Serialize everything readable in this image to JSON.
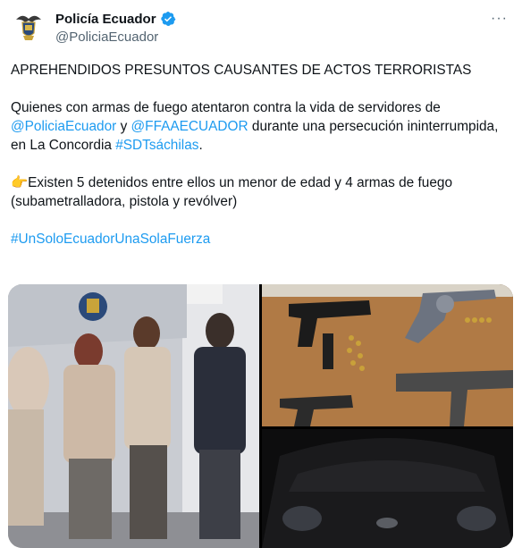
{
  "author": {
    "display_name": "Policía Ecuador",
    "handle": "@PoliciaEcuador",
    "avatar_icon": "police-crest-icon",
    "verified_icon": "verified-badge-icon",
    "verified_color": "#1d9bf0"
  },
  "more_label": "···",
  "tweet": {
    "headline": "APREHENDIDOS PRESUNTOS CAUSANTES DE ACTOS TERRORISTAS",
    "p1_text1": "Quienes con armas de fuego atentaron contra la vida de servidores de ",
    "p1_mention1": "@PoliciaEcuador",
    "p1_text2": " y ",
    "p1_mention2": "@FFAAECUADOR",
    "p1_text3": " durante una persecución ininterrumpida, en La Concordia ",
    "p1_hashtag": "#SDTsáchilas",
    "p1_text4": ".",
    "p2_emoji": "👉",
    "p2_text": "Existen 5 detenidos entre ellos un menor de edad y 4 armas de fuego (subametralladora, pistola y revólver)",
    "hashtag": "#UnSoloEcuadorUnaSolaFuerza"
  },
  "media": {
    "photos": [
      {
        "subject": "detained-suspects-photo"
      },
      {
        "subject": "seized-weapons-photo"
      },
      {
        "subject": "vehicle-photo"
      }
    ]
  },
  "colors": {
    "link": "#1d9bf0",
    "text": "#0f1419",
    "secondary": "#536471"
  }
}
